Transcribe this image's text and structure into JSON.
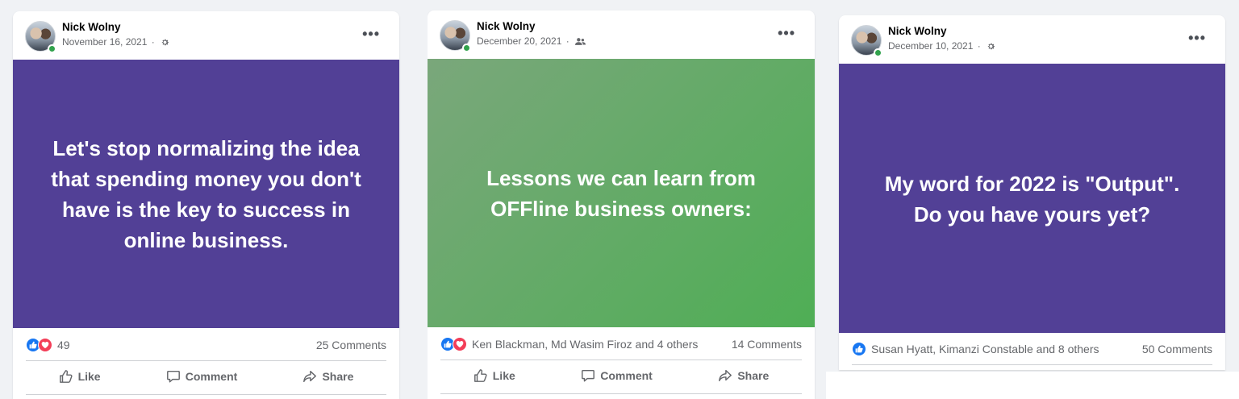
{
  "posts": [
    {
      "author": "Nick Wolny",
      "date": "November 16, 2021",
      "separator": "·",
      "audience_icon": "gear-icon",
      "more_label": "•••",
      "text": "Let's stop normalizing the idea\nthat spending money you don't\nhave is the key to success in\nonline business.",
      "background": "#524096",
      "reactions": [
        "like",
        "love"
      ],
      "reaction_text": "49",
      "comments": "25 Comments",
      "actions": {
        "like": "Like",
        "comment": "Comment",
        "share": "Share"
      }
    },
    {
      "author": "Nick Wolny",
      "date": "December 20, 2021",
      "separator": "·",
      "audience_icon": "friends-icon",
      "more_label": "•••",
      "text": "Lessons we can learn from\nOFFline business owners:",
      "background_gradient": [
        "#7aa77b",
        "#4fae55"
      ],
      "reactions": [
        "like",
        "love"
      ],
      "reaction_text": "Ken Blackman, Md Wasim Firoz and 4 others",
      "comments": "14 Comments",
      "actions": {
        "like": "Like",
        "comment": "Comment",
        "share": "Share"
      }
    },
    {
      "author": "Nick Wolny",
      "date": "December 10, 2021",
      "separator": "·",
      "audience_icon": "gear-icon",
      "more_label": "•••",
      "text": "My word for 2022 is \"Output\".\nDo you have yours yet?",
      "background": "#524096",
      "reactions": [
        "like"
      ],
      "reaction_text": "Susan Hyatt, Kimanzi Constable and 8 others",
      "comments": "50 Comments"
    }
  ],
  "colors": {
    "accent_like": "#1877f2",
    "accent_love": "#f33e58",
    "online": "#31a24c",
    "text_secondary": "#65676b"
  }
}
